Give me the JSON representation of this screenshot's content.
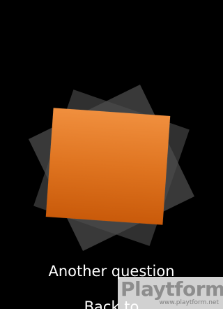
{
  "menu": {
    "another_question": "Another question",
    "back_to": "Back to"
  },
  "watermark": {
    "brand": "Playtform",
    "url": "www.playtform.net"
  },
  "colors": {
    "background": "#000000",
    "card_orange_top": "#f08f3e",
    "card_orange_bottom": "#c95a0a",
    "card_gray": "#5c5c5c",
    "menu_text": "#ffffff"
  }
}
